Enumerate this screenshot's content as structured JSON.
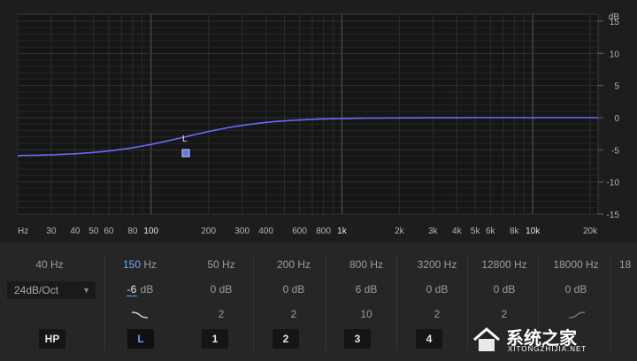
{
  "graph": {
    "x_ticks": [
      "Hz",
      "30",
      "40",
      "50",
      "60",
      "80",
      "100",
      "200",
      "300",
      "400",
      "600",
      "800",
      "1k",
      "2k",
      "3k",
      "4k",
      "5k",
      "6k",
      "8k",
      "10k",
      "20k"
    ],
    "y_ticks": [
      "dB",
      "15",
      "10",
      "5",
      "0",
      "-5",
      "-10",
      "-15"
    ],
    "band_marker_label": "L",
    "curve_color": "#6a6aff",
    "marker_color": "#5a7ae0"
  },
  "bands": [
    {
      "id": "hp",
      "freq": "40 Hz",
      "slope": "24dB/Oct",
      "button": "HP"
    },
    {
      "id": "l",
      "freq_value": "150",
      "freq_unit": " Hz",
      "gain_value": "-6",
      "gain_unit": " dB",
      "button": "L"
    },
    {
      "id": "1",
      "freq": "50 Hz",
      "gain": "0 dB",
      "q": "2",
      "button": "1"
    },
    {
      "id": "2",
      "freq": "200 Hz",
      "gain": "0 dB",
      "q": "2",
      "button": "2"
    },
    {
      "id": "3",
      "freq": "800 Hz",
      "gain": "6 dB",
      "q": "10",
      "button": "3"
    },
    {
      "id": "4",
      "freq": "3200 Hz",
      "gain": "0 dB",
      "q": "2",
      "button": "4"
    },
    {
      "id": "5",
      "freq": "12800 Hz",
      "gain": "0 dB",
      "q": "2"
    },
    {
      "id": "h",
      "freq": "18000 Hz",
      "gain": "0 dB"
    },
    {
      "id": "lp",
      "freq": "18"
    }
  ],
  "watermark": {
    "text": "系统之家",
    "subtext": "XITONGZHIJIA.NET"
  }
}
